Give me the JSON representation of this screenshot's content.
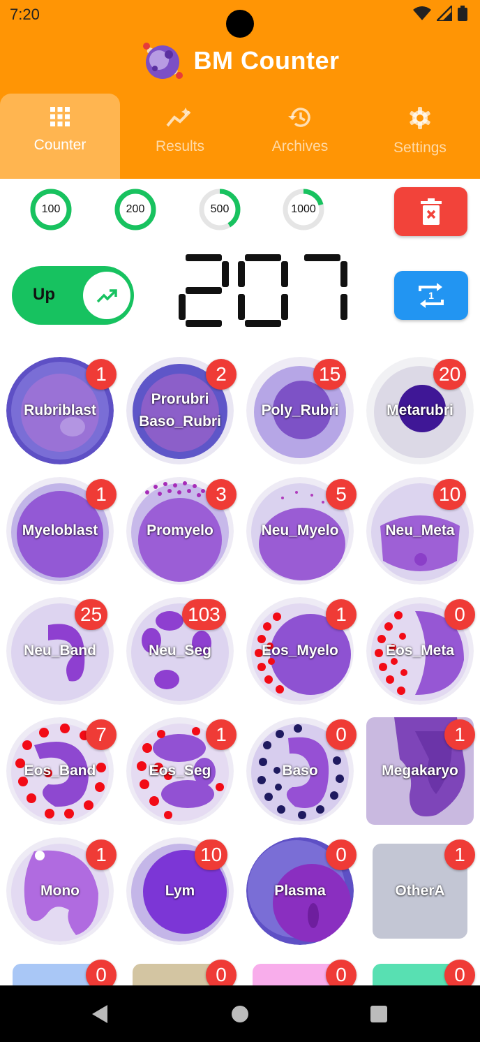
{
  "status_bar": {
    "time": "7:20"
  },
  "app": {
    "title": "BM Counter"
  },
  "tabs": [
    {
      "label": "Counter",
      "icon": "grid-icon",
      "active": true
    },
    {
      "label": "Results",
      "icon": "trending-icon",
      "active": false
    },
    {
      "label": "Archives",
      "icon": "history-icon",
      "active": false
    },
    {
      "label": "Settings",
      "icon": "gear-icon",
      "active": false
    }
  ],
  "goals": [
    {
      "label": "100",
      "progress": 1.0
    },
    {
      "label": "200",
      "progress": 1.0
    },
    {
      "label": "500",
      "progress": 0.414
    },
    {
      "label": "1000",
      "progress": 0.207
    }
  ],
  "toggle": {
    "label": "Up",
    "icon": "trending-up-icon"
  },
  "counter": {
    "value": "207"
  },
  "cells": [
    {
      "name": "Rubriblast",
      "count": "1"
    },
    {
      "name": "Prorubri Baso_Rubri",
      "line1": "Prorubri",
      "line2": "Baso_Rubri",
      "count": "2"
    },
    {
      "name": "Poly_Rubri",
      "count": "15"
    },
    {
      "name": "Metarubri",
      "count": "20"
    },
    {
      "name": "Myeloblast",
      "count": "1"
    },
    {
      "name": "Promyelo",
      "count": "3"
    },
    {
      "name": "Neu_Myelo",
      "count": "5"
    },
    {
      "name": "Neu_Meta",
      "count": "10"
    },
    {
      "name": "Neu_Band",
      "count": "25"
    },
    {
      "name": "Neu_Seg",
      "count": "103"
    },
    {
      "name": "Eos_Myelo",
      "count": "1"
    },
    {
      "name": "Eos_Meta",
      "count": "0"
    },
    {
      "name": "Eos_Band",
      "count": "7"
    },
    {
      "name": "Eos_Seg",
      "count": "1"
    },
    {
      "name": "Baso",
      "count": "0"
    },
    {
      "name": "Megakaryo",
      "count": "1"
    },
    {
      "name": "Mono",
      "count": "1"
    },
    {
      "name": "Lym",
      "count": "10"
    },
    {
      "name": "Plasma",
      "count": "0"
    },
    {
      "name": "OtherA",
      "count": "1"
    }
  ],
  "extra_counts": [
    "0",
    "0",
    "0",
    "0"
  ],
  "extra_colors": [
    "#A9C7F6",
    "#D3C5A2",
    "#F8ADEB",
    "#58E0B2"
  ],
  "colors": {
    "header": "#FF9505",
    "badge": "#EF3B36",
    "toggle": "#17C260",
    "delete": "#F2433A",
    "swap": "#2295F2"
  }
}
